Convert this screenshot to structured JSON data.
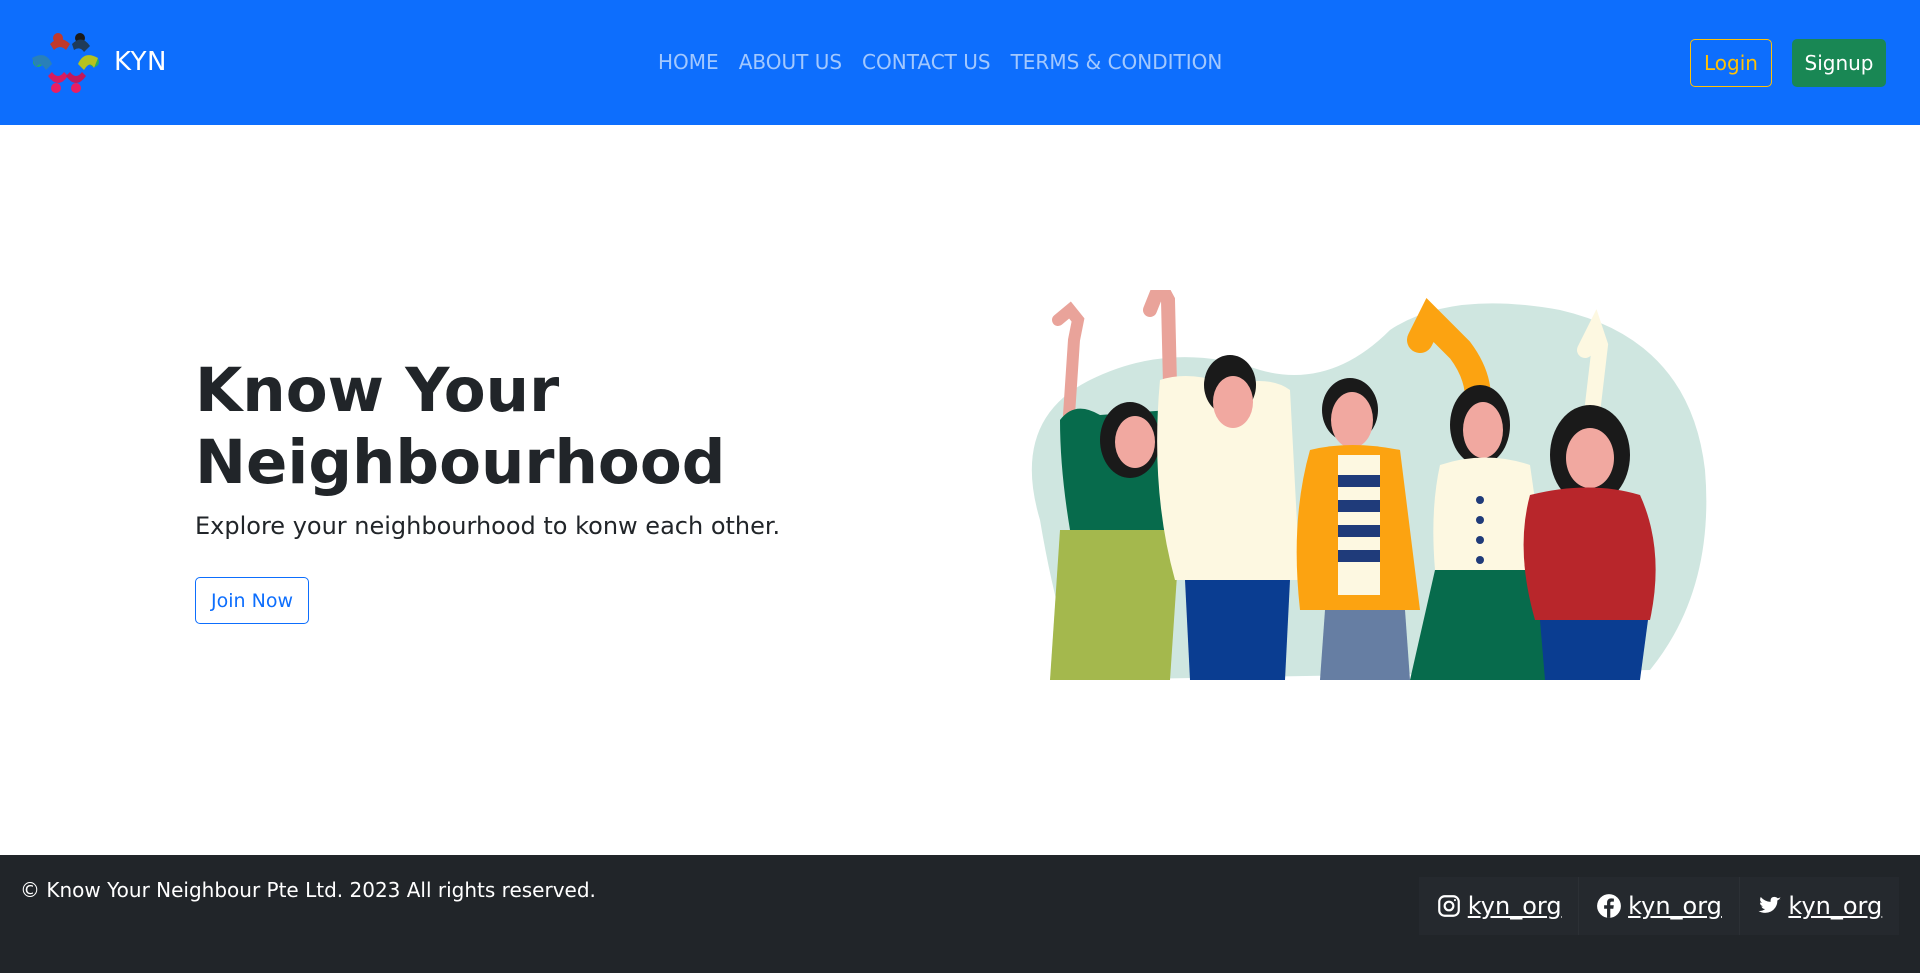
{
  "navbar": {
    "brand": "KYN",
    "logo_icon": "community-logo-icon",
    "links": [
      "HOME",
      "ABOUT US",
      "CONTACT US",
      "TERMS & CONDITION"
    ],
    "login_label": "Login",
    "signup_label": "Signup"
  },
  "hero": {
    "title": "Know Your Neighbourhood",
    "subtitle": "Explore your neighbourhood to konw each other.",
    "join_label": "Join Now",
    "illustration_icon": "people-waving-illustration"
  },
  "footer": {
    "copyright": "© Know Your Neighbour Pte Ltd. 2023 All rights reserved.",
    "socials": [
      {
        "icon": "instagram-icon",
        "label": " kyn_org"
      },
      {
        "icon": "facebook-icon",
        "label": " kyn_org"
      },
      {
        "icon": "twitter-icon",
        "label": " kyn_org"
      }
    ]
  },
  "colors": {
    "primary": "#0d6efd",
    "warning": "#ffc107",
    "success": "#198754",
    "dark": "#212529"
  }
}
